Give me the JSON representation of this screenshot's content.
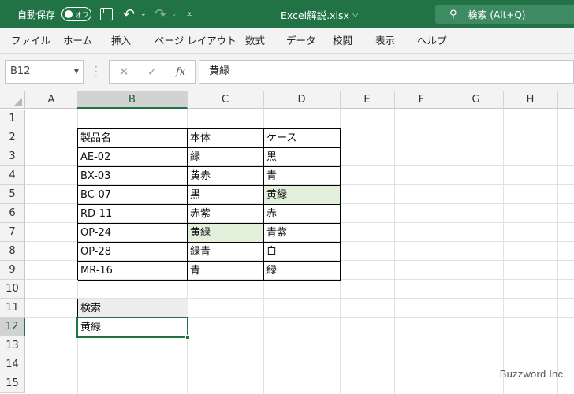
{
  "titlebar": {
    "autosave_label": "自動保存",
    "autosave_state": "オフ",
    "title": "Excel解説.xlsx",
    "title_chevron": "⌵",
    "undo_glyph": "↶",
    "redo_glyph": "↷",
    "dropdown_glyph": "⌄",
    "qat_more_glyph": "⩡",
    "search_label": "検索 (Alt+Q)",
    "search_glyph": "⚲",
    "bg_color": "#217346"
  },
  "ribbon": {
    "tabs": [
      "ファイル",
      "ホーム",
      "挿入",
      "ページ レイアウト",
      "数式",
      "データ",
      "校閲",
      "表示",
      "ヘルプ"
    ]
  },
  "formula_bar": {
    "name_box": "B12",
    "name_box_dropdown": "▼",
    "cancel_glyph": "✕",
    "enter_glyph": "✓",
    "fx_label": "fx",
    "formula": "黄緑"
  },
  "grid": {
    "columns": [
      "A",
      "B",
      "C",
      "D",
      "E",
      "F",
      "G",
      "H"
    ],
    "rows": [
      "1",
      "2",
      "3",
      "4",
      "5",
      "6",
      "7",
      "8",
      "9",
      "10",
      "11",
      "12",
      "13",
      "14",
      "15"
    ],
    "selected_column": "B",
    "selected_row": "12",
    "table": {
      "headers": [
        "製品名",
        "本体",
        "ケース"
      ],
      "rows": [
        [
          "AE-02",
          "緑",
          "黒"
        ],
        [
          "BX-03",
          "黄赤",
          "青"
        ],
        [
          "BC-07",
          "黒",
          "黄緑"
        ],
        [
          "RD-11",
          "赤紫",
          "赤"
        ],
        [
          "OP-24",
          "黄緑",
          "青紫"
        ],
        [
          "OP-28",
          "緑青",
          "白"
        ],
        [
          "MR-16",
          "青",
          "緑"
        ]
      ]
    },
    "search_header": "検索",
    "search_value": "黄緑",
    "highlight_color": "#e2efda"
  },
  "watermark": "Buzzword Inc."
}
